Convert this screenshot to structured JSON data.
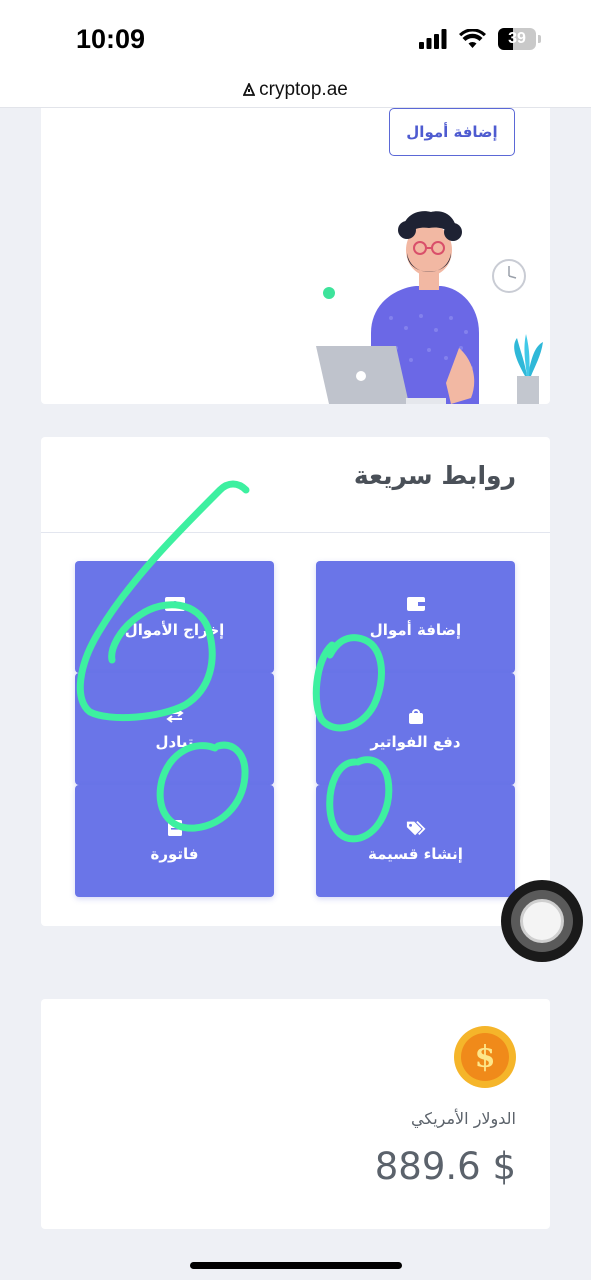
{
  "status_bar": {
    "time": "10:09",
    "battery_level": "39",
    "battery_fraction": 0.39,
    "icons": [
      "signal-icon",
      "wifi-icon",
      "battery-icon"
    ]
  },
  "browser": {
    "url": "cryptop.ae",
    "url_icon": "lock-icon"
  },
  "top_card": {
    "add_funds_label": "إضافة أموال",
    "illustration": "man-with-laptop-illustration"
  },
  "quick_links": {
    "title": "روابط سريعة",
    "items": [
      {
        "label": "إضافة أموال",
        "icon": "wallet-icon"
      },
      {
        "label": "إخراج الأموال",
        "icon": "wallet-out-icon"
      },
      {
        "label": "دفع الفواتير",
        "icon": "shopping-bag-icon"
      },
      {
        "label": "تبادل",
        "icon": "exchange-icon"
      },
      {
        "label": "إنشاء قسيمة",
        "icon": "tags-icon"
      },
      {
        "label": "فاتورة",
        "icon": "invoice-icon"
      }
    ]
  },
  "balance_card": {
    "icon": "dollar-coin-icon",
    "coin_symbol": "$",
    "currency_name": "الدولار الأمريكي",
    "amount": "889.6 $"
  },
  "colors": {
    "tile": "#6a75e8",
    "accent": "#4e5bd0",
    "annotation": "#3df0a0",
    "coin": "#f5b52a"
  }
}
